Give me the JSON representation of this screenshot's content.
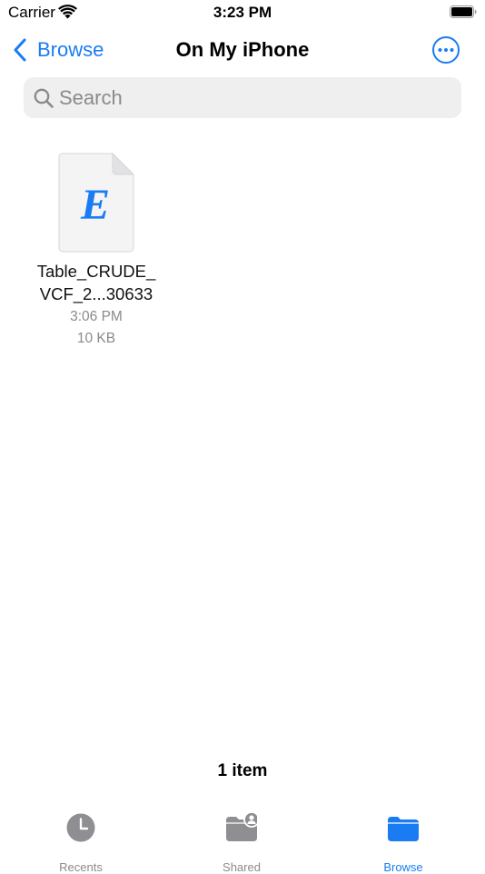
{
  "status_bar": {
    "carrier": "Carrier",
    "time": "3:23 PM"
  },
  "nav": {
    "back_label": "Browse",
    "title": "On My iPhone"
  },
  "search": {
    "placeholder": "Search"
  },
  "files": [
    {
      "name_line1": "Table_CRUDE_",
      "name_line2": "VCF_2...30633",
      "thumb_letter": "E",
      "time": "3:06 PM",
      "size": "10 KB"
    }
  ],
  "footer": {
    "item_count": "1 item"
  },
  "tabs": [
    {
      "label": "Recents",
      "icon": "clock-icon",
      "active": false
    },
    {
      "label": "Shared",
      "icon": "shared-folder-icon",
      "active": false
    },
    {
      "label": "Browse",
      "icon": "folder-icon",
      "active": true
    }
  ],
  "colors": {
    "accent": "#1a7cf3",
    "secondary_text": "#8a8a8e",
    "search_bg": "#efeff0",
    "inactive_icon": "#8e8e93"
  }
}
